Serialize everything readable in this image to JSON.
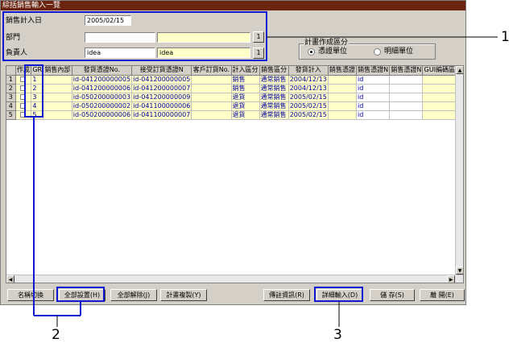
{
  "window": {
    "title": "綜括銷售輸入一覽"
  },
  "form": {
    "sales_date_label": "銷售計入日",
    "sales_date_value": "2005/02/15",
    "dept_label": "部門",
    "dept_code": "",
    "dept_name": "",
    "person_label": "負責人",
    "person_code": "idea",
    "person_name": "idea",
    "lookup_button": "1"
  },
  "plan_group": {
    "label": "計畫作成區分",
    "options": [
      {
        "label": "憑證單位",
        "selected": true
      },
      {
        "label": "明細單位",
        "selected": false
      }
    ]
  },
  "grid": {
    "columns": [
      "作成",
      "GR",
      "銷售內部",
      "發貨憑證No.",
      "接受訂貨憑證N",
      "客戶訂貨No.",
      "計入區分",
      "銷售區分",
      "發貨計入",
      "銷售憑證",
      "銷售憑證N",
      "銷售憑證N",
      "GUI編碼區分"
    ],
    "rows": [
      {
        "num": "1",
        "gr": "1",
        "ship_no": "id-041200000005",
        "order_no": "id-041200000005",
        "entry": "銷售",
        "sales_type": "通常銷售",
        "ship_date": "2004/12/13",
        "voucher_n": "id"
      },
      {
        "num": "2",
        "gr": "2",
        "ship_no": "id-041200000006",
        "order_no": "id-041200000007",
        "entry": "銷售",
        "sales_type": "通常銷售",
        "ship_date": "2004/12/13",
        "voucher_n": "id"
      },
      {
        "num": "3",
        "gr": "3",
        "ship_no": "id-050200000003",
        "order_no": "id-041200000009",
        "entry": "退貨",
        "sales_type": "通常銷售",
        "ship_date": "2005/02/15",
        "voucher_n": "id"
      },
      {
        "num": "4",
        "gr": "4",
        "ship_no": "id-050200000002",
        "order_no": "id-041100000006",
        "entry": "退貨",
        "sales_type": "通常銷售",
        "ship_date": "2005/02/15",
        "voucher_n": "id"
      },
      {
        "num": "5",
        "gr": "5",
        "ship_no": "id-050200000006",
        "order_no": "id-041100000007",
        "entry": "退貨",
        "sales_type": "通常銷售",
        "ship_date": "2005/02/15",
        "voucher_n": "id"
      }
    ]
  },
  "buttons": {
    "rename": "名稱切換",
    "select_all": "全部設置(H)",
    "clear_all": "全部解除(J)",
    "copy_plan": "計畫複製(Y)",
    "memo_info": "傳註資訊(R)",
    "detail_input": "詳細輸入(D)",
    "save": "儲 存(S)",
    "close": "離 開(E)"
  },
  "callouts": {
    "c1": "1",
    "c2": "2",
    "c3": "3"
  },
  "colors": {
    "highlight": "#1018d0",
    "titlebar": "#6b2410",
    "cell_yellow": "#ffffc8"
  },
  "icons": {
    "radio": "radio-button-icon",
    "scroll": "scroll-arrow-icon"
  }
}
